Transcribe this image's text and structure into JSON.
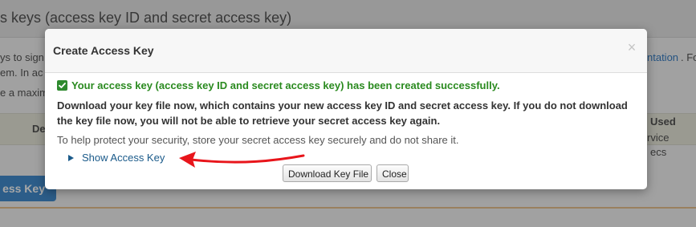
{
  "background": {
    "title": "s keys (access key ID and secret access key)",
    "line1_left": "ys to sign",
    "line1_right_link": "ntation",
    "line1_right_text": ". Fo",
    "line2_left": "em. In ac",
    "line3_left": "e a maxim",
    "table_col_left": "De",
    "table_col_right": "Used",
    "table_col_right2": "rvice",
    "row_right": "ecs",
    "create_button": "ess Key"
  },
  "modal": {
    "title": "Create Access Key",
    "close_glyph": "×",
    "success_message": "Your access key (access key ID and secret access key) has been created successfully.",
    "warning_message": "Download your key file now, which contains your new access key ID and secret access key. If you do not download the key file now, you will not be able to retrieve your secret access key again.",
    "help_message": "To help protect your security, store your secret access key securely and do not share it.",
    "show_key_label": "Show Access Key",
    "download_button": "Download Key File",
    "close_button": "Close"
  },
  "icons": {
    "success": "check-icon",
    "expand": "triangle-right-icon",
    "annotation": "red-arrow-icon"
  },
  "colors": {
    "success_green": "#2a8a1f",
    "link_blue": "#1a5a8a",
    "annotation_red": "#e8151b"
  }
}
